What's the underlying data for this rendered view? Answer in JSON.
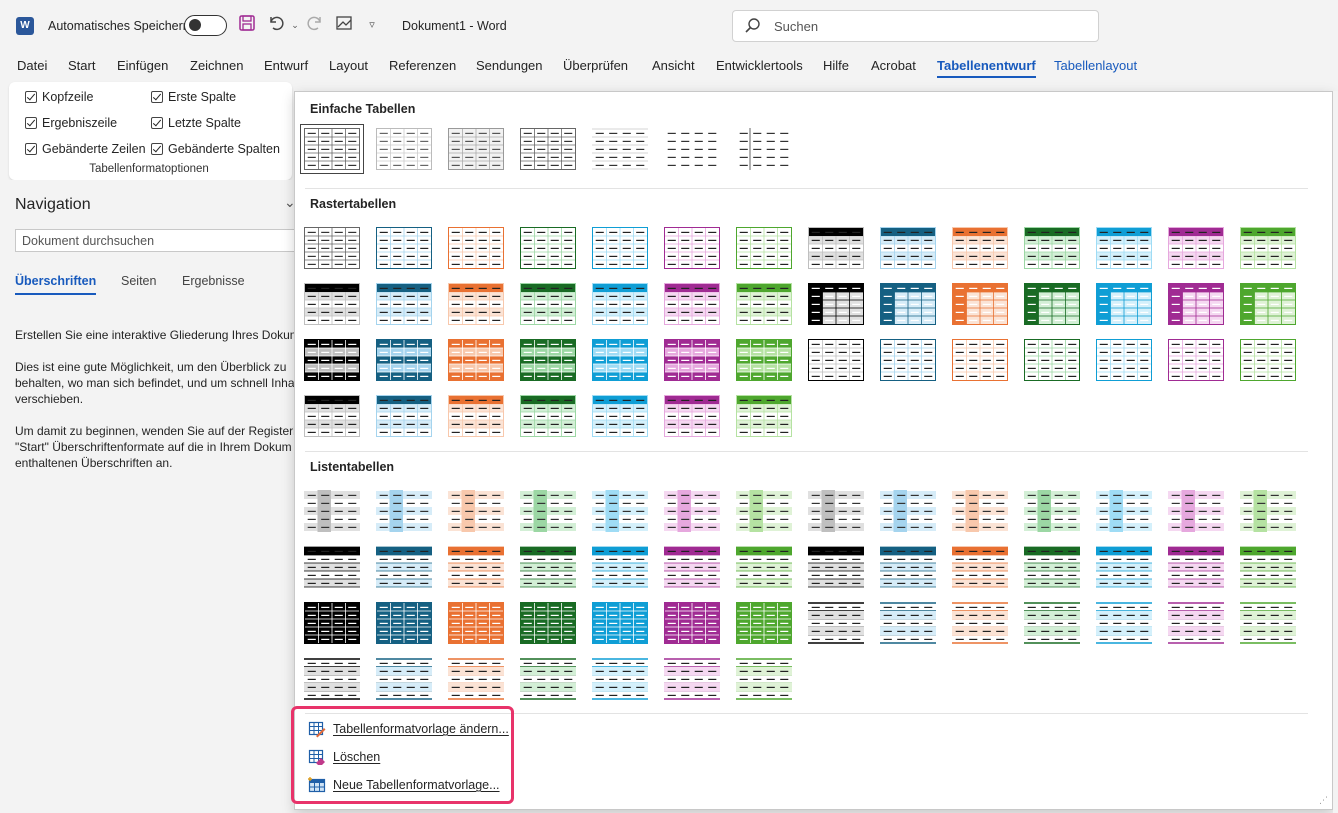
{
  "titlebar": {
    "autosave_label": "Automatisches Speichern",
    "autosave_on": false,
    "doc_title": "Dokument1  -  Word",
    "search_placeholder": "Suchen"
  },
  "tabs": [
    {
      "label": "Datei"
    },
    {
      "label": "Start"
    },
    {
      "label": "Einfügen"
    },
    {
      "label": "Zeichnen"
    },
    {
      "label": "Entwurf"
    },
    {
      "label": "Layout"
    },
    {
      "label": "Referenzen"
    },
    {
      "label": "Sendungen"
    },
    {
      "label": "Überprüfen"
    },
    {
      "label": "Ansicht"
    },
    {
      "label": "Entwicklertools"
    },
    {
      "label": "Hilfe"
    },
    {
      "label": "Acrobat"
    },
    {
      "label": "Tabellenentwurf",
      "active": true
    },
    {
      "label": "Tabellenlayout",
      "contextual": true
    }
  ],
  "options": {
    "items": [
      {
        "label": "Kopfzeile",
        "checked": true
      },
      {
        "label": "Ergebniszeile",
        "checked": true
      },
      {
        "label": "Gebänderte Zeilen",
        "checked": true
      },
      {
        "label": "Erste Spalte",
        "checked": true
      },
      {
        "label": "Letzte Spalte",
        "checked": true
      },
      {
        "label": "Gebänderte Spalten",
        "checked": true
      }
    ],
    "group_label": "Tabellenformatoptionen"
  },
  "navigation": {
    "title": "Navigation",
    "search_placeholder": "Dokument durchsuchen",
    "tabs": [
      "Überschriften",
      "Seiten",
      "Ergebnisse"
    ],
    "lines": [
      "Erstellen Sie eine interaktive Gliederung Ihres Dokume",
      "Dies ist eine gute Möglichkeit, um den Überblick zu",
      "behalten, wo man sich befindet, und um schnell Inha",
      "verschieben.",
      "Um damit zu beginnen, wenden Sie auf der Registerk",
      "\"Start\" Überschriftenformate auf die in Ihrem Dokum",
      "enthaltenen Überschriften an."
    ]
  },
  "gallery": {
    "sections": [
      {
        "title": "Einfache Tabellen"
      },
      {
        "title": "Rastertabellen"
      },
      {
        "title": "Listentabellen"
      }
    ],
    "palette": [
      "#000000",
      "#156082",
      "#e97132",
      "#196b24",
      "#0f9ed5",
      "#a02b93",
      "#4ea72e"
    ],
    "menu": [
      {
        "label": "Tabellenformatvorlage ändern...",
        "icon": "table-edit-icon"
      },
      {
        "label": "Löschen",
        "icon": "table-eraser-icon"
      },
      {
        "label": "Neue Tabellenformatvorlage...",
        "icon": "new-table-style-icon"
      }
    ]
  }
}
